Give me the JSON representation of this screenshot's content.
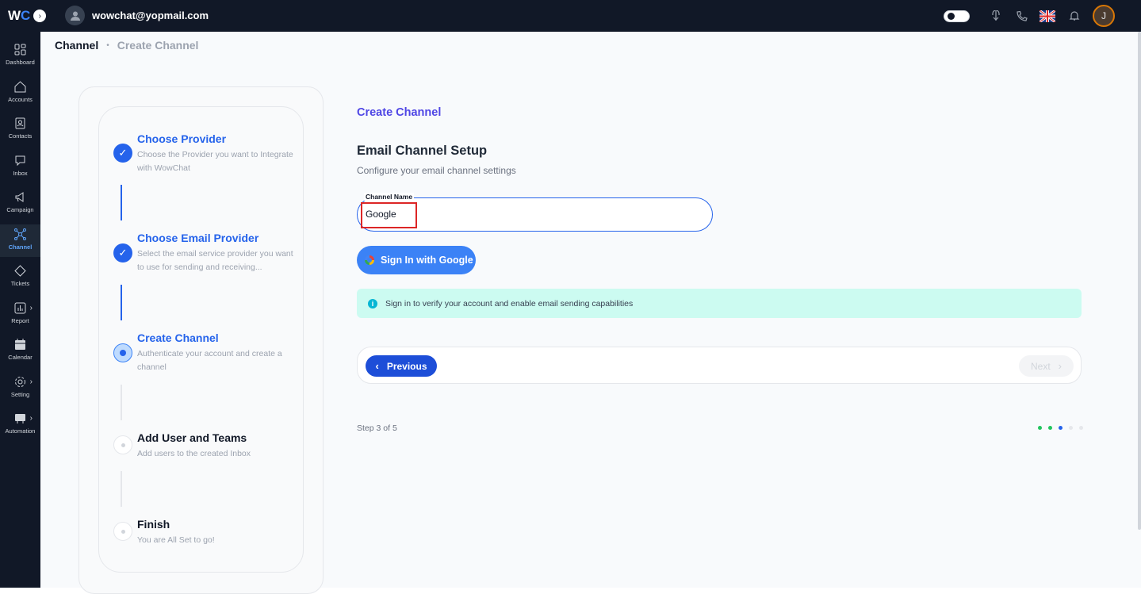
{
  "header": {
    "logo_w": "W",
    "logo_c": "C",
    "user_email": "wowchat@yopmail.com",
    "avatar_initial": "J"
  },
  "sidebar": {
    "items": [
      {
        "label": "Dashboard",
        "icon": "dashboard-icon"
      },
      {
        "label": "Accounts",
        "icon": "home-icon"
      },
      {
        "label": "Contacts",
        "icon": "contact-card-icon"
      },
      {
        "label": "Inbox",
        "icon": "chat-icon"
      },
      {
        "label": "Campaign",
        "icon": "megaphone-icon"
      },
      {
        "label": "Channel",
        "icon": "channel-icon",
        "active": true
      },
      {
        "label": "Tickets",
        "icon": "ticket-icon"
      },
      {
        "label": "Report",
        "icon": "report-icon"
      },
      {
        "label": "Calendar",
        "icon": "calendar-icon"
      },
      {
        "label": "Setting",
        "icon": "gear-icon"
      },
      {
        "label": "Automation",
        "icon": "automation-icon"
      }
    ]
  },
  "breadcrumb": {
    "root": "Channel",
    "current": "Create Channel"
  },
  "steps": [
    {
      "title": "Choose Provider",
      "desc": "Choose the Provider you want to Integrate with WowChat",
      "status": "done"
    },
    {
      "title": "Choose Email Provider",
      "desc": "Select the email service provider you want to use for sending and receiving...",
      "status": "done"
    },
    {
      "title": "Create Channel",
      "desc": "Authenticate your account and create a channel",
      "status": "current"
    },
    {
      "title": "Add User and Teams",
      "desc": "Add users to the created Inbox",
      "status": "pending"
    },
    {
      "title": "Finish",
      "desc": "You are All Set to go!",
      "status": "pending"
    }
  ],
  "panel": {
    "title": "Create Channel",
    "setup_title": "Email Channel Setup",
    "setup_sub": "Configure your email channel settings",
    "field_label": "Channel Name",
    "field_value": "Google",
    "google_btn": "Sign In with Google",
    "info_text": "Sign in to verify your account and enable email sending capabilities",
    "prev_label": "Previous",
    "next_label": "Next",
    "step_count": "Step 3 of 5"
  },
  "progress_dots": [
    "#22c55e",
    "#22c55e",
    "#2563eb",
    "#e5e7eb",
    "#e5e7eb"
  ],
  "colors": {
    "accent": "#2563eb",
    "sidebar_bg": "#111827",
    "info_bg": "#ccfbf1"
  }
}
